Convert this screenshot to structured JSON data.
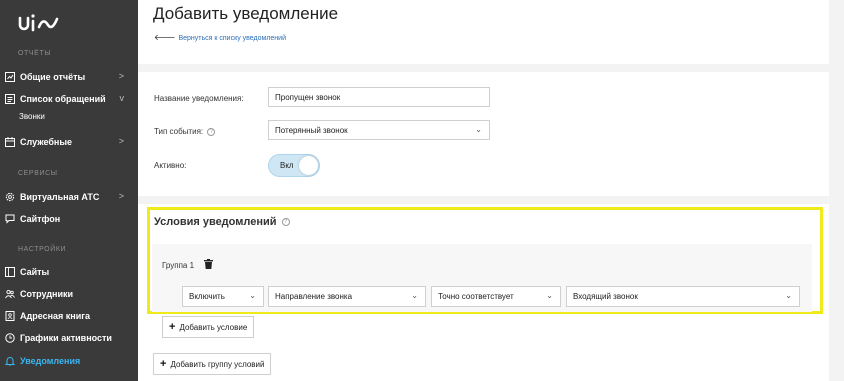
{
  "sidebar": {
    "logo": "uis",
    "sections": {
      "reports": "ОТЧЁТЫ",
      "services": "СЕРВИСЫ",
      "settings": "НАСТРОЙКИ"
    },
    "items": [
      {
        "label": "Общие отчёты",
        "icon": "report-icon",
        "chevron": ">"
      },
      {
        "label": "Список обращений",
        "icon": "list-icon",
        "chevron": "v"
      },
      {
        "label": "Служебные",
        "icon": "calendar-icon",
        "chevron": ">"
      },
      {
        "label": "Виртуальная АТС",
        "icon": "gear-icon",
        "chevron": ">"
      },
      {
        "label": "Сайтфон",
        "icon": "phone-chat-icon",
        "chevron": ""
      },
      {
        "label": "Сайты",
        "icon": "site-icon",
        "chevron": ""
      },
      {
        "label": "Сотрудники",
        "icon": "users-icon",
        "chevron": ""
      },
      {
        "label": "Адресная книга",
        "icon": "address-book-icon",
        "chevron": ""
      },
      {
        "label": "Графики активности",
        "icon": "clock-icon",
        "chevron": ""
      },
      {
        "label": "Уведомления",
        "icon": "bell-icon",
        "chevron": ""
      }
    ],
    "subitem": "Звонки",
    "active_color": "#3ab6f0"
  },
  "header": {
    "title": "Добавить уведомление",
    "back_arrow": "🡐",
    "back_link": "Вернуться к списку уведомлений"
  },
  "form": {
    "name_label": "Название уведомления:",
    "name_value": "Пропущен звонок",
    "event_label": "Тип события:",
    "event_value": "Потерянный звонок",
    "active_label": "Активно:",
    "toggle_label": "Вкл"
  },
  "conditions": {
    "title": "Условия уведомлений",
    "group_label": "Группа 1",
    "include_value": "Включить",
    "field_value": "Направление звонка",
    "operator_value": "Точно соответствует",
    "value_value": "Входящий звонок",
    "add_condition": "Добавить условие",
    "add_group": "Добавить группу условий",
    "highlight_color": "#f1ea1b"
  },
  "glyphs": {
    "dropdown": "⌄",
    "plus": "+",
    "help": "?"
  }
}
